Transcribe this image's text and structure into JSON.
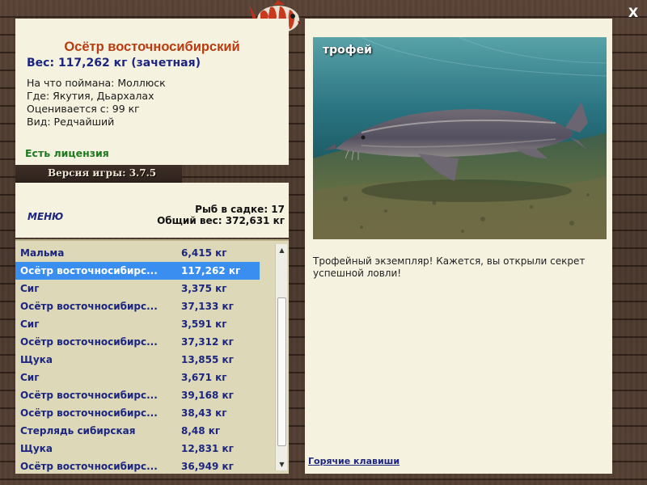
{
  "close_label": "X",
  "info": {
    "title": "Осётр восточносибирский",
    "weight": "Вес: 117,262 кг (зачетная)",
    "bait": "На что поймана: Моллюск",
    "location": "Где: Якутия, Дьархалах",
    "rated_from": "Оценивается с: 99 кг",
    "kind": "Вид: Редчайший",
    "license": "Есть лицензия"
  },
  "version": "Версия игры: 3.7.5",
  "menu": {
    "label": "МЕНЮ",
    "cage_count": "Рыб в садке: 17",
    "total_weight": "Общий вес: 372,631 кг"
  },
  "fish_list": [
    {
      "name": "Мальма",
      "weight": "6,415 кг"
    },
    {
      "name": "Осётр восточносибирс...",
      "weight": "117,262 кг"
    },
    {
      "name": "Сиг",
      "weight": "3,375 кг"
    },
    {
      "name": "Осётр восточносибирс...",
      "weight": "37,133 кг"
    },
    {
      "name": "Сиг",
      "weight": "3,591 кг"
    },
    {
      "name": "Осётр восточносибирс...",
      "weight": "37,312 кг"
    },
    {
      "name": "Щука",
      "weight": "13,855 кг"
    },
    {
      "name": "Сиг",
      "weight": "3,671 кг"
    },
    {
      "name": "Осётр восточносибирс...",
      "weight": "39,168 кг"
    },
    {
      "name": "Осётр восточносибирс...",
      "weight": "38,43 кг"
    },
    {
      "name": "Стерлядь сибирская",
      "weight": "8,48 кг"
    },
    {
      "name": "Щука",
      "weight": "12,831 кг"
    },
    {
      "name": "Осётр восточносибирс...",
      "weight": "36,949 кг"
    }
  ],
  "photo": {
    "label": "трофей",
    "description": "Трофейный экземпляр! Кажется, вы открыли секрет успешной ловли!"
  },
  "hotkeys_label": "Горячие клавиши",
  "colors": {
    "title": "#b83c10",
    "accent_text": "#1c2680",
    "license": "#1f7a1f",
    "selected_row": "#3a8ef0",
    "panel_bg": "#f5f2e0",
    "list_bg": "#dcd8b8"
  }
}
